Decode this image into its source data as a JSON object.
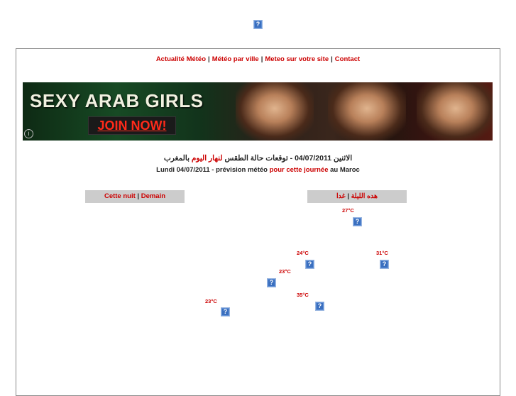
{
  "top_nav": {
    "items": [
      "Actualité Météo",
      "Météo par ville",
      "Meteo sur votre site",
      "Contact"
    ],
    "separator": "|"
  },
  "banner": {
    "title": "SEXY ARAB GIRLS",
    "cta": "JOIN NOW!",
    "info_icon": "i"
  },
  "forecast_header": {
    "arabic_prefix": "الاثنين 04/07/2011 - توقعات حالة الطقس ",
    "arabic_highlight": "لنهار اليوم",
    "arabic_suffix": " بالمغرب",
    "french_prefix": "Lundi 04/07/2011 - prévision météo ",
    "french_highlight": "pour cette journée",
    "french_suffix": " au Maroc"
  },
  "tabs_fr": {
    "tonight": "Cette nuit",
    "separator": "|",
    "tomorrow": "Demain"
  },
  "tabs_ar": {
    "tonight": "هده الليلة",
    "separator": "|",
    "tomorrow": "غدا"
  },
  "temperatures": [
    "27°C",
    "24°C",
    "31°C",
    "23°C",
    "35°C",
    "23°C"
  ],
  "icons": {
    "broken_image": "?"
  }
}
